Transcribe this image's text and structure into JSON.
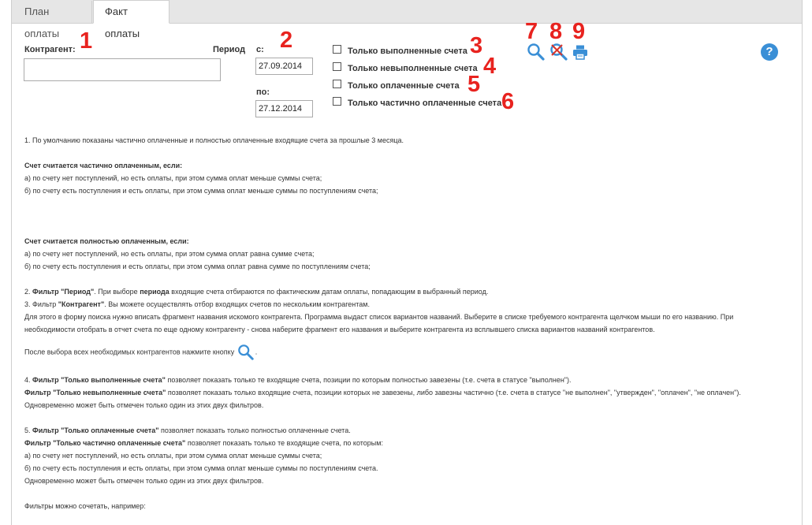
{
  "tabs": [
    {
      "label": "План оплаты"
    },
    {
      "label": "Факт оплаты"
    }
  ],
  "filters": {
    "contractor_label": "Контрагент:",
    "contractor_value": "",
    "period_label": "Период",
    "from_label": "с:",
    "from_value": "27.09.2014",
    "to_label": "по:",
    "to_value": "27.12.2014",
    "checkboxes": [
      {
        "label": "Только выполненные счета",
        "checked": false
      },
      {
        "label": "Только невыполненные счета",
        "checked": false
      },
      {
        "label": "Только оплаченные счета",
        "checked": false
      },
      {
        "label": "Только частично оплаченные счета",
        "checked": false
      }
    ]
  },
  "markers": [
    "1",
    "2",
    "3",
    "4",
    "5",
    "6",
    "7",
    "8",
    "9"
  ],
  "icons": {
    "search": "search-icon",
    "clear": "clear-filter-icon",
    "print": "printer-icon",
    "help": "help-icon",
    "help_symbol": "?"
  },
  "colors": {
    "marker": "#e8231f",
    "icon_blue": "#3a8fd6"
  },
  "help_text": {
    "p1": "1. По умолчанию показаны частично оплаченные и полностью оплаченные входящие счета за прошлые 3 месяца.",
    "partial_title": "Счет считается частично оплаченным, если:",
    "partial_a": "а) по счету нет поступлений, но есть оплаты, при этом сумма оплат меньше суммы счета;",
    "partial_b": "б) по счету есть поступления и есть оплаты, при этом сумма оплат меньше суммы по поступлениям счета;",
    "full_title": "Счет считается полностью оплаченным, если:",
    "full_a": "а) по счету нет поступлений, но есть оплаты, при этом сумма оплат равна сумме счета;",
    "full_b": "б) по счету есть поступления и есть оплаты, при этом сумма оплат равна сумме по поступлениям счета;",
    "p2_num": "2.",
    "p2_bold": "Фильтр \"Период\"",
    "p2_a": ". При выборе",
    "p2_bold2": "периода",
    "p2_b": "входящие счета отбираются по фактическим датам оплаты, попадающим в выбранный период.",
    "p3_num": "3. Фильтр",
    "p3_bold": "\"Контрагент\"",
    "p3_text": ". Вы можете осуществлять отбор входящих счетов по нескольким контрагентам.",
    "p3_b": "Для этого в форму поиска нужно вписать фрагмент названия искомого контрагента. Программа выдаст список вариантов названий. Выберите в списке требуемого контрагента щелчком мыши по его названию. При необходимости отобрать в отчет счета по еще одному контрагенту - снова наберите фрагмент его названия и выберите контрагента из всплывшего списка вариантов названий контрагентов.",
    "p3_c": "После выбора всех необходимых контрагентов нажмите кнопку",
    "p4_num": "4.",
    "p4_bold": "Фильтр \"Только выполненные счета\"",
    "p4_text": "позволяет показать только те входящие счета, позиции по которым полностью завезены (т.е. счета в статусе \"выполнен\").",
    "p4b_bold": "Фильтр \"Только невыполненные счета\"",
    "p4b_text": "позволяет показать только входящие счета, позиции которых не завезены, либо завезны частично (т.е. счета в статусе \"не выполнен\", \"утвержден\", \"оплачен\", \"не оплачен\").",
    "p4_note": "Одновременно может быть отмечен только один из этих двух фильтров.",
    "p5_num": "5.",
    "p5_bold": "Фильтр \"Только оплаченные счета\"",
    "p5_text": "позволяет показать только полностью оплаченные счета.",
    "p6_bold": "Фильтр \"Только частично оплаченные счета\"",
    "p6_text": "позволяет показать только те входящие счета, по которым:",
    "p6_a": "а) по счету нет поступлений, но есть оплаты, при этом сумма оплат меньше суммы счета;",
    "p6_b": "б) по счету есть поступления и есть оплаты, при этом сумма оплат меньше суммы по поступлениям счета.",
    "p6_note": "Одновременно может быть отмечен только один из этих двух фильтров.",
    "p7": "Фильтры можно сочетать, например:"
  }
}
